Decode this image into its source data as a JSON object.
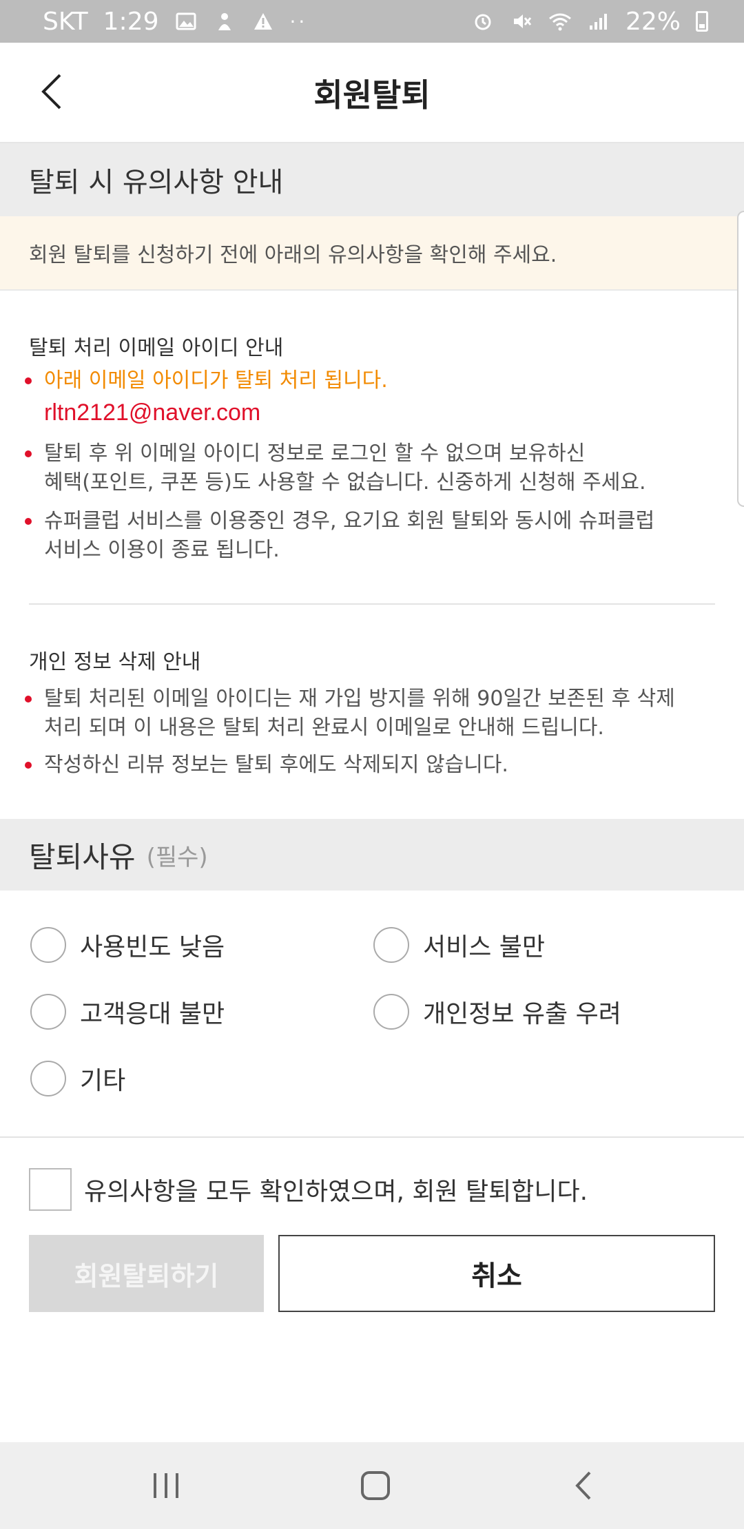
{
  "status_bar": {
    "carrier": "SKT",
    "time": "1:29",
    "battery_percent": "22%",
    "dots": "··"
  },
  "header": {
    "title": "회원탈퇴"
  },
  "notice": {
    "heading": "탈퇴 시 유의사항 안내",
    "banner": "회원 탈퇴를 신청하기 전에 아래의 유의사항을 확인해 주세요.",
    "email_section": {
      "title": "탈퇴 처리 이메일 아이디 안내",
      "highlight": "아래 이메일 아이디가 탈퇴 처리 됩니다.",
      "email": "rltn2121@naver.com",
      "bullet2_line1": "탈퇴 후 위 이메일 아이디 정보로 로그인 할 수 없으며 보유하신",
      "bullet2_line2": "혜택(포인트, 쿠폰 등)도 사용할 수 없습니다. 신중하게 신청해 주세요.",
      "bullet3_line1": "슈퍼클럽 서비스를 이용중인 경우, 요기요 회원 탈퇴와 동시에 슈퍼클럽",
      "bullet3_line2": "서비스 이용이 종료 됩니다."
    },
    "privacy_section": {
      "title": "개인 정보 삭제 안내",
      "bullet1_line1": "탈퇴 처리된 이메일 아이디는 재 가입 방지를 위해 90일간 보존된 후 삭제",
      "bullet1_line2": "처리 되며 이 내용은 탈퇴 처리 완료시 이메일로 안내해 드립니다.",
      "bullet2": "작성하신 리뷰 정보는 탈퇴 후에도 삭제되지 않습니다."
    }
  },
  "reason": {
    "heading": "탈퇴사유",
    "required": "(필수)",
    "options": [
      "사용빈도 낮음",
      "서비스 불만",
      "고객응대 불만",
      "개인정보 유출 우려",
      "기타"
    ]
  },
  "agree": {
    "label": "유의사항을 모두 확인하였으며, 회원 탈퇴합니다."
  },
  "buttons": {
    "withdraw": "회원탈퇴하기",
    "cancel": "취소"
  },
  "colors": {
    "accent_red": "#e0102a",
    "accent_orange": "#f28a00",
    "section_bg": "#ececec",
    "banner_bg": "#fdf6ea"
  }
}
